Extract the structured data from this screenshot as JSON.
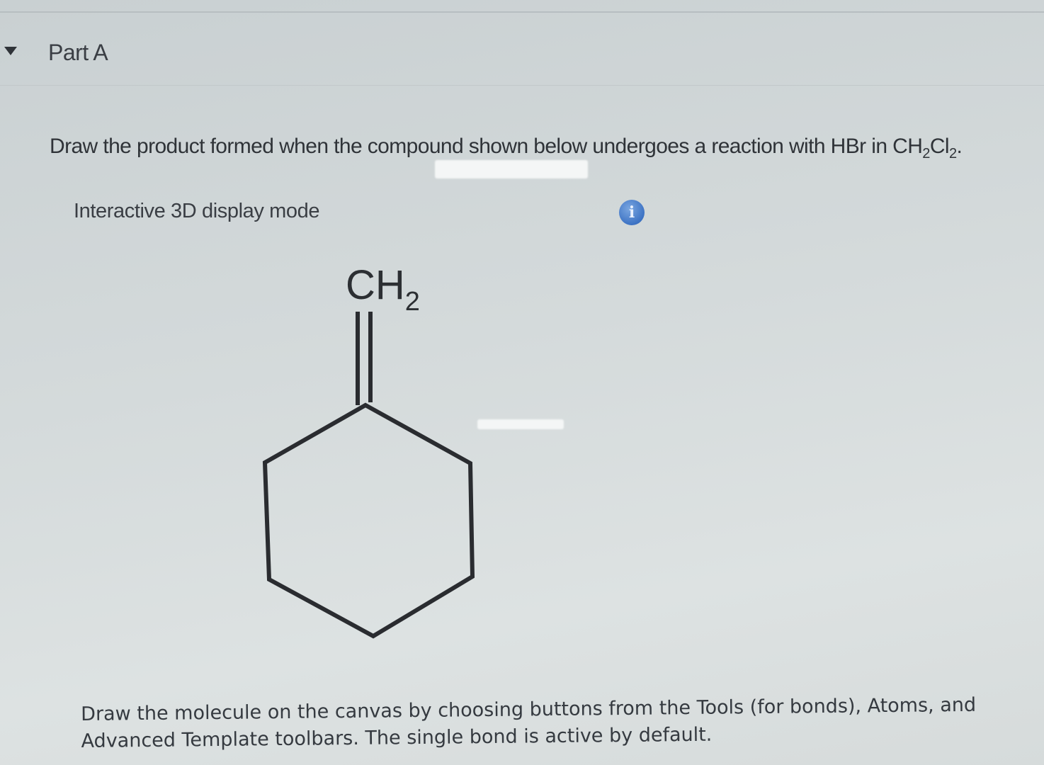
{
  "part": {
    "title": "Part A"
  },
  "question": {
    "prefix": "Draw the product formed when the compound shown below undergoes a reaction with HBr in CH",
    "sub1": "2",
    "mid": "Cl",
    "sub2": "2",
    "suffix": "."
  },
  "display_mode": {
    "label": "Interactive 3D display mode",
    "info_glyph": "i"
  },
  "molecule": {
    "group_main": "CH",
    "group_sub": "2"
  },
  "instructions": {
    "line1": "Draw the molecule on the canvas by choosing buttons from the Tools (for bonds), Atoms, and",
    "line2": "Advanced Template toolbars. The single bond is active by default."
  },
  "icons": {
    "collapse": "caret-down-icon",
    "info": "info-icon"
  },
  "colors": {
    "info_blue": "#3d73c4",
    "text": "#2f3338"
  }
}
